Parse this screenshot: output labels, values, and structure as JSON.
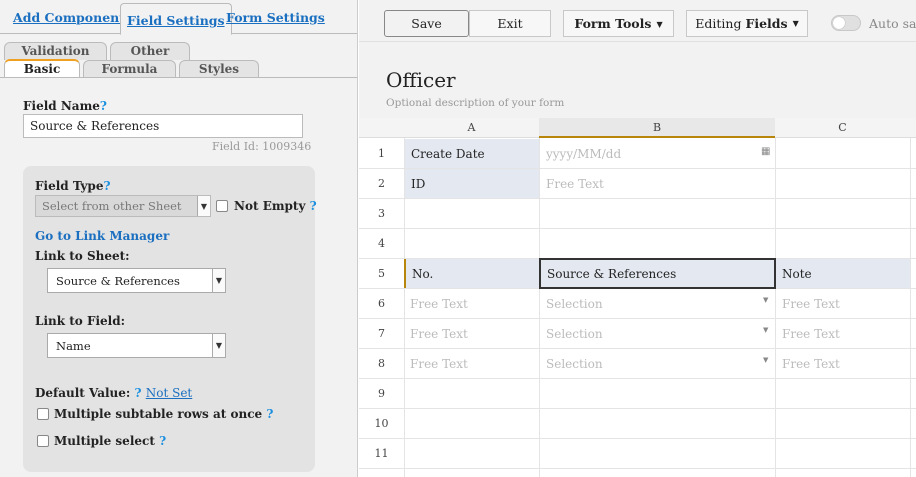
{
  "left_panel": {
    "top_tabs": [
      "Add Components",
      "Field Settings",
      "Form Settings"
    ],
    "sub_tabs_back": [
      "Validation",
      "Other"
    ],
    "sub_tabs_front": [
      "Basic",
      "Formula",
      "Styles"
    ],
    "field_name_label": "Field Name",
    "help_mark": "?",
    "field_name_value": "Source & References",
    "field_id": "Field Id: 1009346",
    "field_type_label": "Field Type",
    "field_type_value": "Select from other Sheet",
    "not_empty_label": "Not Empty",
    "link_manager": "Go to Link Manager",
    "link_sheet_label": "Link to Sheet:",
    "link_sheet_value": "Source & References",
    "link_field_label": "Link to Field:",
    "link_field_value": "Name",
    "default_value_label": "Default Value:",
    "default_value_link": "Not Set",
    "multi_subtable_label": "Multiple subtable rows at once",
    "multi_select_label": "Multiple select"
  },
  "toolbar": {
    "save": "Save",
    "exit": "Exit",
    "form_tools": "Form Tools",
    "editing_prefix": "Editing",
    "editing_bold": "Fields",
    "autosave": "Auto save"
  },
  "form": {
    "title": "Officer",
    "description": "Optional description of your form"
  },
  "grid": {
    "columns": [
      "A",
      "B",
      "C"
    ],
    "rows": [
      "1",
      "2",
      "3",
      "4",
      "5",
      "6",
      "7",
      "8",
      "9",
      "10",
      "11"
    ],
    "cells": {
      "a1": "Create Date",
      "b1": "yyyy/MM/dd",
      "a2": "ID",
      "b2": "Free Text",
      "a5": "No.",
      "b5": "Source & References",
      "c5": "Note",
      "a6": "Free Text",
      "b6": "Selection",
      "c6": "Free Text",
      "a7": "Free Text",
      "b7": "Selection",
      "c7": "Free Text",
      "a8": "Free Text",
      "b8": "Selection",
      "c8": "Free Text"
    }
  },
  "colors": {
    "link": "#1a6fc0",
    "help": "#1a8fe0",
    "tab_accent": "#f0a020",
    "cell_shade": "#e4e8f0",
    "selected_col": "#b8860b"
  }
}
